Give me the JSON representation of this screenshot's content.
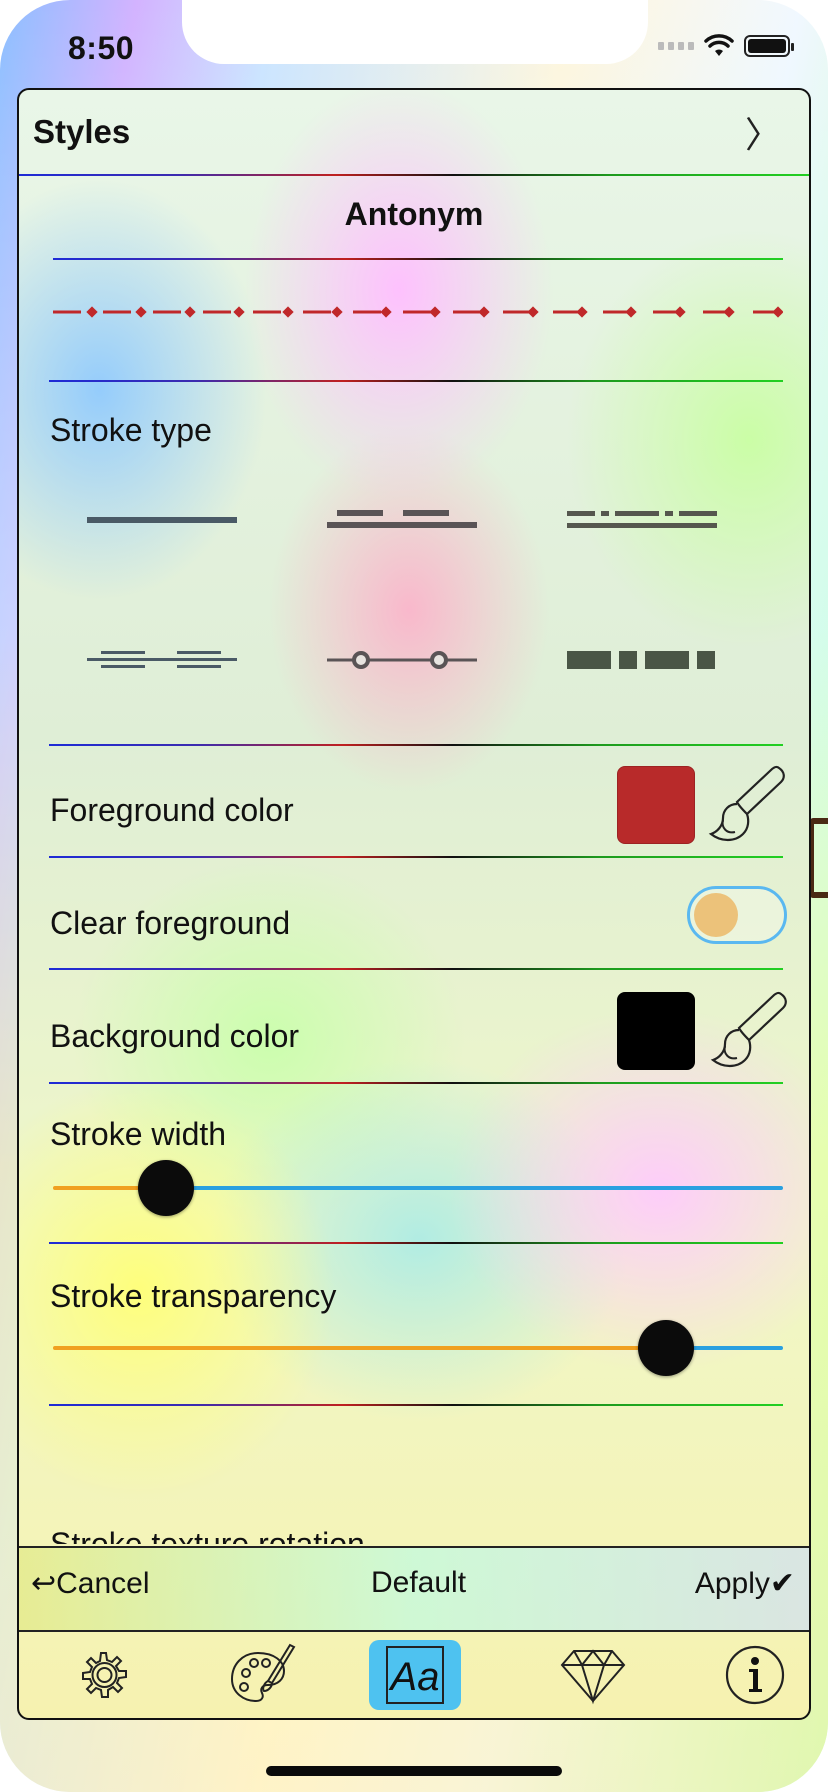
{
  "status_bar": {
    "time": "8:50"
  },
  "header": {
    "title": "Styles",
    "chevron": "〉"
  },
  "style_name": "Antonym",
  "sections": {
    "stroke_type_label": "Stroke type",
    "stroke_types": [
      {
        "name": "solid"
      },
      {
        "name": "dashed"
      },
      {
        "name": "dash-dot"
      },
      {
        "name": "double"
      },
      {
        "name": "circle-dot"
      },
      {
        "name": "block"
      }
    ],
    "foreground_color_label": "Foreground color",
    "clear_foreground_label": "Clear foreground",
    "background_color_label": "Background color",
    "stroke_width_label": "Stroke width",
    "stroke_transparency_label": "Stroke transparency",
    "stroke_texture_rotation_label": "Stroke texture rotation"
  },
  "values": {
    "foreground_color": "#b82a2a",
    "background_color": "#000000",
    "clear_foreground": false,
    "stroke_width_fraction": 0.155,
    "stroke_transparency_fraction": 0.84
  },
  "colors": {
    "preview_stroke": "#c0282a",
    "toggle_border": "#5ab8f0",
    "toggle_knob": "#ecc27a",
    "slider_filled": "#f0a020",
    "slider_unfilled": "#2aa0e0",
    "active_tab": "#4ec2f0"
  },
  "action_bar": {
    "cancel": "↩Cancel",
    "default": "Default",
    "apply": "Apply✔"
  },
  "tabs": [
    {
      "icon": "gear-icon"
    },
    {
      "icon": "palette-icon"
    },
    {
      "icon": "text-style-icon",
      "label": "Aa",
      "active": true
    },
    {
      "icon": "diamond-icon"
    },
    {
      "icon": "info-icon"
    }
  ]
}
